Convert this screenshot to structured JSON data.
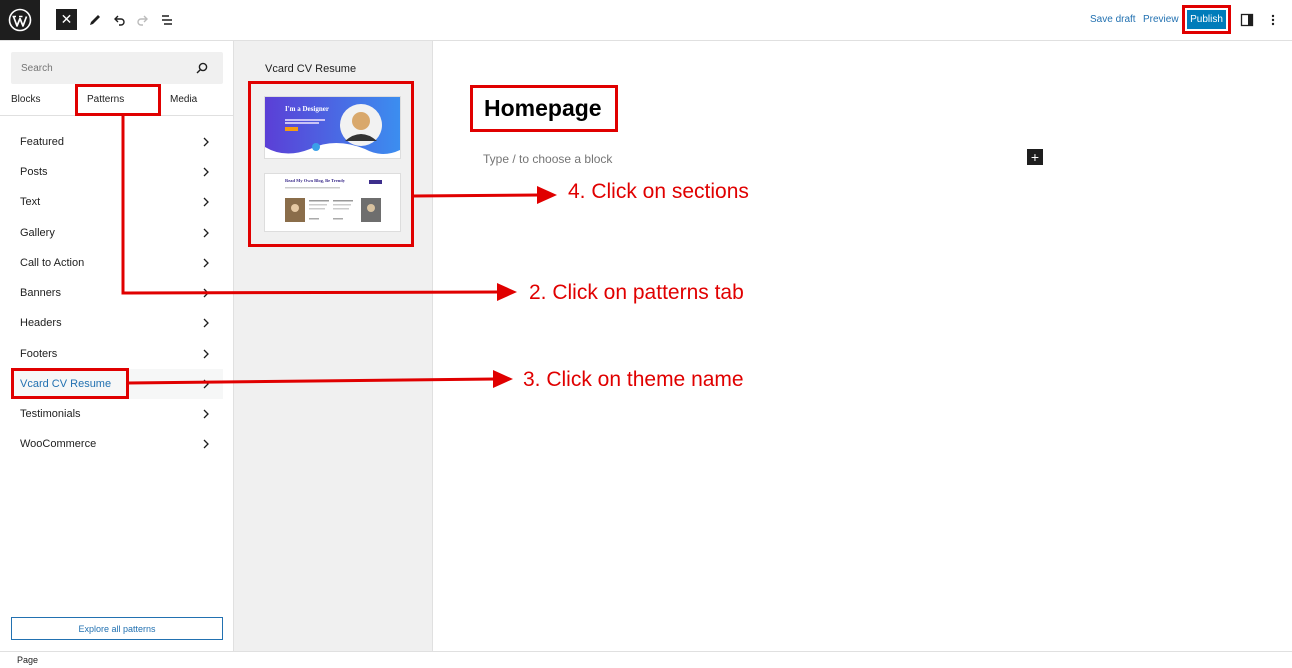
{
  "toolbar": {
    "save_draft": "Save draft",
    "preview": "Preview",
    "publish": "Publish"
  },
  "inserter": {
    "search_placeholder": "Search",
    "tabs": [
      "Blocks",
      "Patterns",
      "Media"
    ],
    "categories": [
      "Featured",
      "Posts",
      "Text",
      "Gallery",
      "Call to Action",
      "Banners",
      "Headers",
      "Footers",
      "Vcard CV Resume",
      "Testimonials",
      "WooCommerce"
    ],
    "active_category": "Vcard CV Resume",
    "explore_button": "Explore all patterns"
  },
  "preview": {
    "title": "Vcard CV Resume",
    "card1_heading": "I'm a Designer",
    "card2_heading": "Read My Own Blog, Be Trendy"
  },
  "canvas": {
    "page_title": "Homepage",
    "block_placeholder": "Type / to choose a block"
  },
  "annotations": {
    "sections": "4. Click on sections",
    "patterns_tab": "2. Click on patterns tab",
    "theme_name": "3. Click on theme name"
  },
  "statusbar": {
    "label": "Page"
  },
  "colors": {
    "accent": "#2271b1",
    "publish": "#007cba",
    "annotation": "#e00000",
    "dark": "#1e1e1e"
  }
}
